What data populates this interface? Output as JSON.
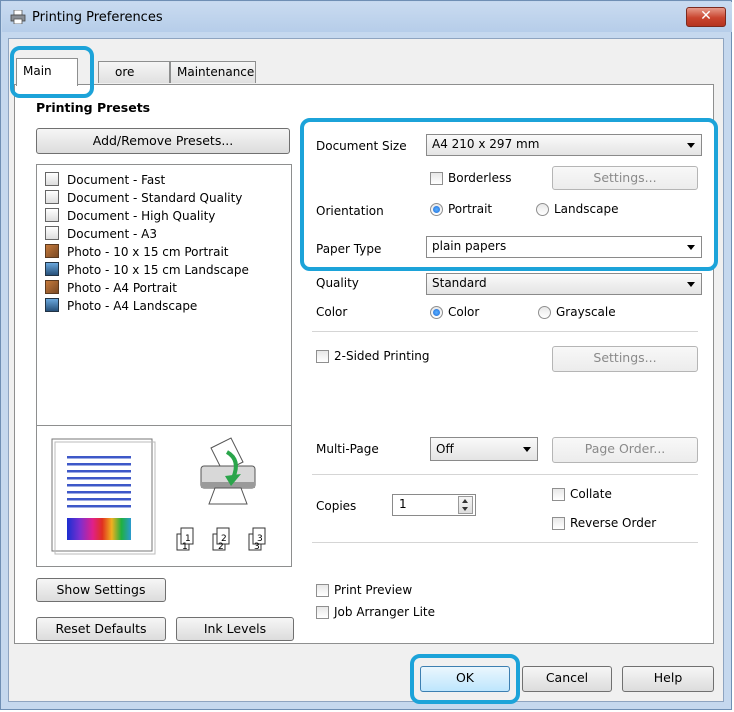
{
  "window": {
    "title": "Printing Preferences",
    "close_glyph": "✕"
  },
  "tabs": [
    {
      "label": "Main"
    },
    {
      "label": "ore Options"
    },
    {
      "label": "Maintenance"
    }
  ],
  "presets": {
    "heading": "Printing Presets",
    "add_remove_label": "Add/Remove Presets...",
    "items": [
      {
        "label": "Document - Fast",
        "icon": "document-icon"
      },
      {
        "label": "Document - Standard Quality",
        "icon": "document-icon"
      },
      {
        "label": "Document - High Quality",
        "icon": "document-icon"
      },
      {
        "label": "Document - A3",
        "icon": "document-icon"
      },
      {
        "label": "Photo - 10 x 15 cm Portrait",
        "icon": "photo-portrait-icon"
      },
      {
        "label": "Photo - 10 x 15 cm Landscape",
        "icon": "photo-landscape-icon"
      },
      {
        "label": "Photo - A4 Portrait",
        "icon": "photo-portrait-icon"
      },
      {
        "label": "Photo - A4 Landscape",
        "icon": "photo-landscape-icon"
      }
    ]
  },
  "preview": {
    "copy_labels": [
      "1",
      "2",
      "3"
    ]
  },
  "settings": {
    "document_size": {
      "label": "Document Size",
      "value": "A4 210 x 297 mm"
    },
    "borderless": {
      "label": "Borderless",
      "checked": false
    },
    "borderless_settings_label": "Settings...",
    "orientation": {
      "label": "Orientation",
      "portrait": "Portrait",
      "landscape": "Landscape",
      "selected": "Portrait"
    },
    "paper_type": {
      "label": "Paper Type",
      "value": "plain papers"
    },
    "quality": {
      "label": "Quality",
      "value": "Standard"
    },
    "color": {
      "label": "Color",
      "color_option": "Color",
      "grayscale_option": "Grayscale",
      "selected": "Color"
    },
    "two_sided": {
      "label": "2-Sided Printing",
      "checked": false,
      "settings_label": "Settings..."
    },
    "multi_page": {
      "label": "Multi-Page",
      "value": "Off",
      "page_order_label": "Page Order..."
    },
    "copies": {
      "label": "Copies",
      "value": "1"
    },
    "collate": {
      "label": "Collate",
      "checked": false
    },
    "reverse_order": {
      "label": "Reverse Order",
      "checked": false
    },
    "print_preview": {
      "label": "Print Preview",
      "checked": false
    },
    "job_arranger": {
      "label": "Job Arranger Lite",
      "checked": false
    }
  },
  "buttons": {
    "show_settings": "Show Settings",
    "reset_defaults": "Reset Defaults",
    "ink_levels": "Ink Levels",
    "ok": "OK",
    "cancel": "Cancel",
    "help": "Help"
  },
  "colors": {
    "highlight": "#1ca3d9",
    "titlebar": "#c5d8ee",
    "close_button": "#c9442e"
  }
}
